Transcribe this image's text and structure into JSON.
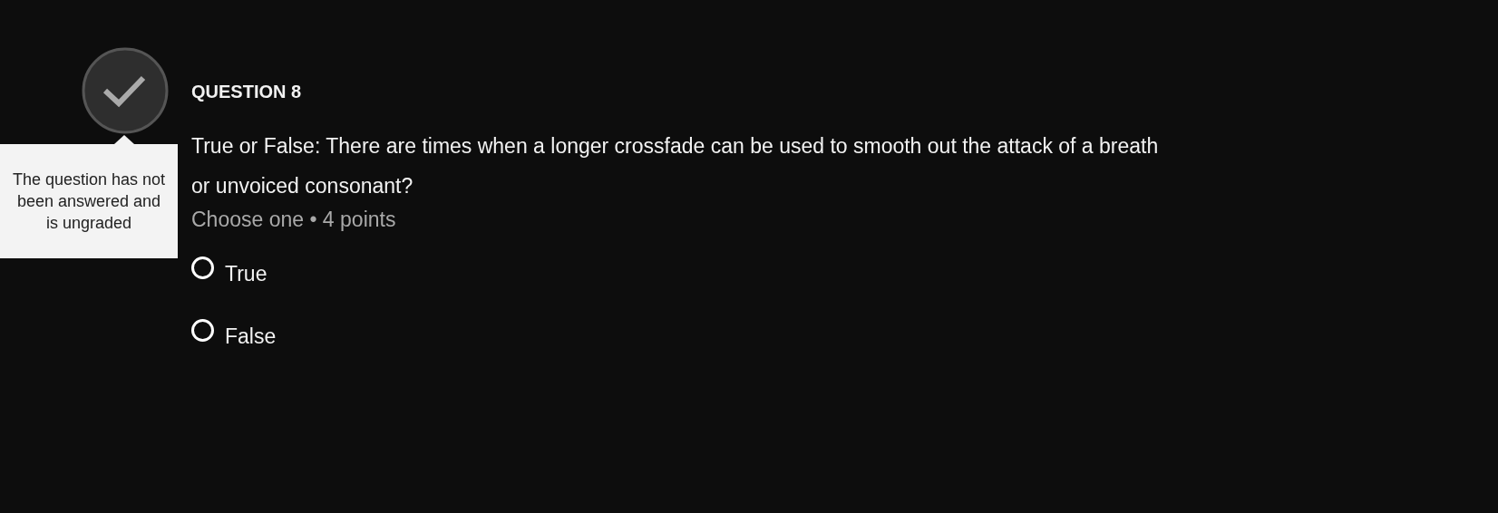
{
  "question": {
    "graded": false,
    "title": "QUESTION 8",
    "text": "True or False: There are times when a longer crossfade can be used to smooth out the attack of a breath or unvoiced consonant?",
    "meta": "Choose one • 4 points",
    "options": [
      {
        "label": "True",
        "selected": false
      },
      {
        "label": "False",
        "selected": false
      }
    ]
  },
  "tooltip": {
    "text": "The question has not been answered and is ungraded"
  }
}
